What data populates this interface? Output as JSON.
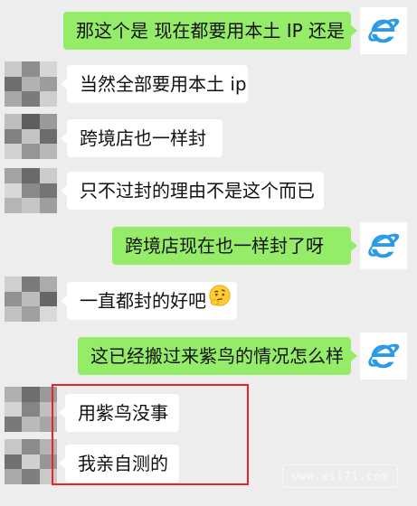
{
  "colors": {
    "background": "#ededed",
    "outgoing_bubble": "#95ec69",
    "incoming_bubble": "#ffffff",
    "highlight": "#e8242a",
    "logo_blue": "#2b9be8"
  },
  "messages": [
    {
      "direction": "out",
      "text": "那这个是 现在都要用本土 IP  还是",
      "avatar_icon": "ie-logo-icon"
    },
    {
      "direction": "in",
      "text": "当然全部要用本土 ip",
      "avatar_icon": "pixelated-avatar"
    },
    {
      "direction": "in",
      "text": "跨境店也一样封",
      "avatar_icon": "pixelated-avatar"
    },
    {
      "direction": "in",
      "text": "只不过封的理由不是这个而已",
      "avatar_icon": "pixelated-avatar"
    },
    {
      "direction": "out",
      "text": "跨境店现在也一样封了呀",
      "avatar_icon": "ie-logo-icon"
    },
    {
      "direction": "in",
      "text": "一直都封的好吧",
      "emoji": "thinking-face-emoji",
      "avatar_icon": "pixelated-avatar"
    },
    {
      "direction": "out",
      "text": "这已经搬过来紫鸟的情况怎么样",
      "avatar_icon": "ie-logo-icon"
    },
    {
      "direction": "in",
      "text": "用紫鸟没事",
      "avatar_icon": "pixelated-avatar"
    },
    {
      "direction": "in",
      "text": "我亲自测的",
      "avatar_icon": "pixelated-avatar"
    }
  ],
  "watermark": "www.ws171.com"
}
